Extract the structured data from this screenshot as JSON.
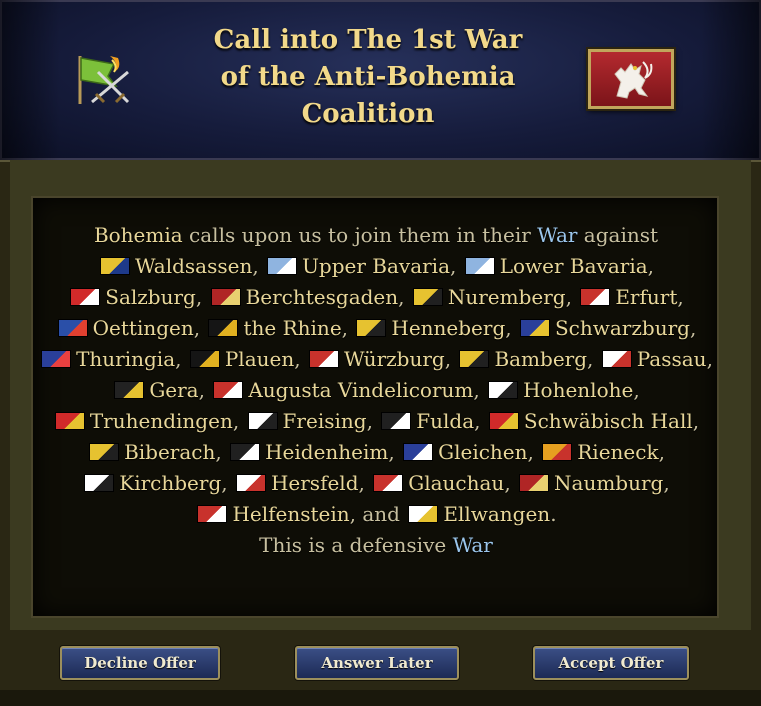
{
  "dialog": {
    "title": "Call into The 1st War of the Anti-Bohemia Coalition"
  },
  "message": {
    "caller": "Bohemia",
    "intro": " calls upon us to join them in their ",
    "war_word": "War",
    "against": " against",
    "members": [
      {
        "name": "Waldsassen",
        "flag": [
          "#e6c230",
          "#1e3a8a"
        ]
      },
      {
        "name": "Upper Bavaria",
        "flag": [
          "#8fb4e0",
          "#ffffff"
        ]
      },
      {
        "name": "Lower Bavaria",
        "flag": [
          "#8fb4e0",
          "#ffffff"
        ]
      },
      {
        "name": "Salzburg",
        "flag": [
          "#d12a2a",
          "#ffffff"
        ]
      },
      {
        "name": "Berchtesgaden",
        "flag": [
          "#b02525",
          "#e8d070"
        ]
      },
      {
        "name": "Nuremberg",
        "flag": [
          "#e6c230",
          "#202020"
        ]
      },
      {
        "name": "Erfurt",
        "flag": [
          "#c8322c",
          "#ffffff"
        ]
      },
      {
        "name": "Oettingen",
        "flag": [
          "#2a4fa8",
          "#e04030"
        ]
      },
      {
        "name": "the Rhine",
        "flag": [
          "#151515",
          "#e0b020"
        ]
      },
      {
        "name": "Henneberg",
        "flag": [
          "#e6c230",
          "#202020"
        ]
      },
      {
        "name": "Schwarzburg",
        "flag": [
          "#2a3f9a",
          "#e6c230"
        ]
      },
      {
        "name": "Thuringia",
        "flag": [
          "#2a3f9a",
          "#e84040"
        ]
      },
      {
        "name": "Plauen",
        "flag": [
          "#151515",
          "#e0b020"
        ]
      },
      {
        "name": "Würzburg",
        "flag": [
          "#c8322c",
          "#ffffff"
        ]
      },
      {
        "name": "Bamberg",
        "flag": [
          "#e6c230",
          "#202020"
        ]
      },
      {
        "name": "Passau",
        "flag": [
          "#ffffff",
          "#c8322c"
        ]
      },
      {
        "name": "Gera",
        "flag": [
          "#222222",
          "#e6c230"
        ]
      },
      {
        "name": "Augusta Vindelicorum",
        "flag": [
          "#c8322c",
          "#ffffff"
        ]
      },
      {
        "name": "Hohenlohe",
        "flag": [
          "#ffffff",
          "#202020"
        ]
      },
      {
        "name": "Truhendingen",
        "flag": [
          "#d12a2a",
          "#e6c230"
        ]
      },
      {
        "name": "Freising",
        "flag": [
          "#ffffff",
          "#202020"
        ]
      },
      {
        "name": "Fulda",
        "flag": [
          "#202020",
          "#ffffff"
        ]
      },
      {
        "name": "Schwäbisch Hall",
        "flag": [
          "#d12a2a",
          "#e6c230"
        ]
      },
      {
        "name": "Biberach",
        "flag": [
          "#e6c230",
          "#202020"
        ]
      },
      {
        "name": "Heidenheim",
        "flag": [
          "#202020",
          "#ffffff"
        ]
      },
      {
        "name": "Gleichen",
        "flag": [
          "#2a3f9a",
          "#ffffff"
        ]
      },
      {
        "name": "Rieneck",
        "flag": [
          "#e6a020",
          "#c8322c"
        ]
      },
      {
        "name": "Kirchberg",
        "flag": [
          "#ffffff",
          "#202020"
        ]
      },
      {
        "name": "Hersfeld",
        "flag": [
          "#ffffff",
          "#c8322c"
        ]
      },
      {
        "name": "Glauchau",
        "flag": [
          "#c8322c",
          "#ffffff"
        ]
      },
      {
        "name": "Naumburg",
        "flag": [
          "#b02525",
          "#e8d070"
        ]
      },
      {
        "name": "Helfenstein",
        "flag": [
          "#c8322c",
          "#ffffff"
        ]
      },
      {
        "name": "Ellwangen",
        "flag": [
          "#ffffff",
          "#e6c230"
        ]
      }
    ],
    "conjunction": "and",
    "footer_prefix": "This is a defensive ",
    "footer_war": "War"
  },
  "buttons": {
    "decline": "Decline Offer",
    "later": "Answer Later",
    "accept": "Accept Offer"
  },
  "colors": {
    "title_gold": "#f2d98a",
    "text_gold": "#e8d79a",
    "link_blue": "#9bc6ec"
  }
}
